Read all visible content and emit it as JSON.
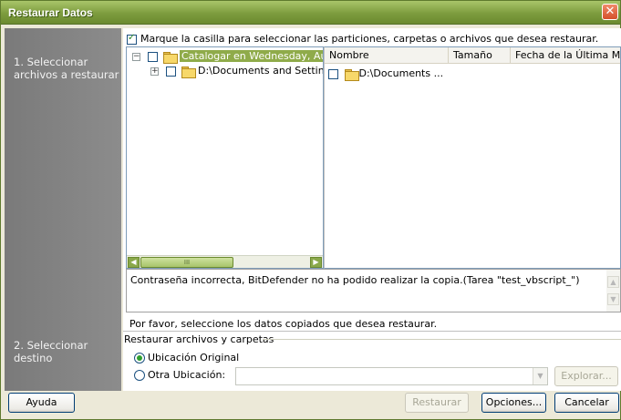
{
  "window": {
    "title": "Restaurar Datos",
    "close_glyph": "✕"
  },
  "sidebar": {
    "step1": "1. Seleccionar archivos a restaurar",
    "step2": "2. Seleccionar destino"
  },
  "selection": {
    "instruction": "Marque la casilla para seleccionar las particiones, carpetas o archivos que desea restaurar.",
    "instruction_checked": true
  },
  "tree": {
    "items": [
      {
        "expander": "−",
        "label": "Catalogar en Wednesday, August",
        "selected": true,
        "icon": "folder-open-icon"
      },
      {
        "expander": "+",
        "label": "D:\\Documents and Settings\\Ad",
        "selected": false,
        "icon": "folder-icon"
      }
    ],
    "scrollbar": {
      "left_arrow": "◀",
      "right_arrow": "▶",
      "thumb_grip": "III"
    }
  },
  "file_list": {
    "columns": [
      "Nombre",
      "Tamaño",
      "Fecha de la Última M..."
    ],
    "rows": [
      {
        "name": "D:\\Documents ...",
        "icon": "folder-icon"
      }
    ]
  },
  "log": {
    "text": "Contraseña incorrecta, BitDefender no ha podido realizar la copia.(Tarea \"test_vbscript_\")",
    "scroll_up": "▲",
    "scroll_down": "▼"
  },
  "status_message": "Por favor, seleccione los datos copiados que desea restaurar.",
  "destination": {
    "group_label": "Restaurar archivos y carpetas",
    "original_label": "Ubicación Original",
    "other_label": "Otra Ubicación:",
    "selected": "original",
    "path_value": "",
    "dropdown_glyph": "▼",
    "browse_label": "Explorar..."
  },
  "buttons": {
    "help": "Ayuda",
    "restore": "Restaurar",
    "options": "Opciones...",
    "cancel": "Cancelar"
  },
  "colors": {
    "titlebar": "#7d9c3e",
    "sidebar": "#838383",
    "selection_highlight": "#8fab4a"
  }
}
